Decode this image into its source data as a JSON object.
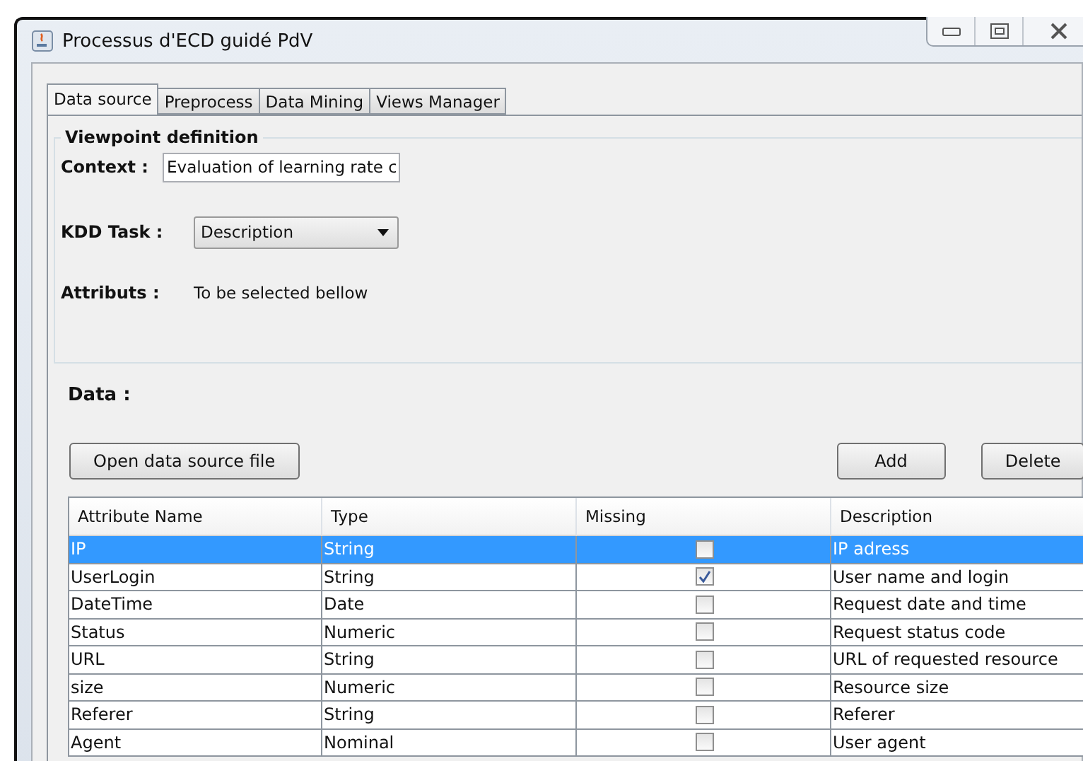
{
  "window": {
    "title": "Processus d'ECD guidé PdV"
  },
  "tabs": [
    {
      "label": "Data source",
      "selected": true
    },
    {
      "label": "Preprocess",
      "selected": false
    },
    {
      "label": "Data Mining",
      "selected": false
    },
    {
      "label": "Views Manager",
      "selected": false
    }
  ],
  "viewpoint": {
    "title": "Viewpoint definition",
    "context_label": "Context :",
    "context_value": "Evaluation of learning rate c",
    "task_label": "KDD Task :",
    "task_value": "Description",
    "attributs_label": "Attributs :",
    "attributs_value": "To be selected bellow"
  },
  "data": {
    "title": "Data :",
    "open_button": "Open data source file",
    "add_button": "Add",
    "delete_button": "Delete"
  },
  "table": {
    "columns": [
      "Attribute Name",
      "Type",
      "Missing",
      "Description"
    ],
    "rows": [
      {
        "name": "IP",
        "type": "String",
        "missing": false,
        "description": "IP adress",
        "selected": true
      },
      {
        "name": "UserLogin",
        "type": "String",
        "missing": true,
        "description": "User name and login",
        "selected": false
      },
      {
        "name": "DateTime",
        "type": "Date",
        "missing": false,
        "description": "Request date and time",
        "selected": false
      },
      {
        "name": "Status",
        "type": "Numeric",
        "missing": false,
        "description": "Request status code",
        "selected": false
      },
      {
        "name": "URL",
        "type": "String",
        "missing": false,
        "description": "URL of requested resource",
        "selected": false
      },
      {
        "name": "size",
        "type": "Numeric",
        "missing": false,
        "description": "Resource size",
        "selected": false
      },
      {
        "name": "Referer",
        "type": "String",
        "missing": false,
        "description": "Referer",
        "selected": false
      },
      {
        "name": "Agent",
        "type": "Nominal",
        "missing": false,
        "description": "User agent",
        "selected": false
      }
    ]
  }
}
